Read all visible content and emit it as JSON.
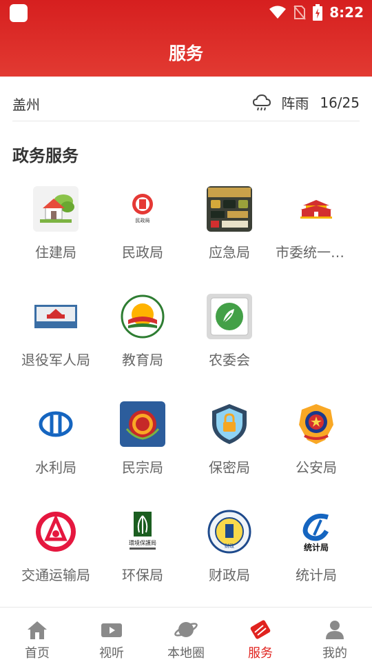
{
  "status": {
    "time": "8:22"
  },
  "header": {
    "title": "服务"
  },
  "weather": {
    "city": "盖州",
    "icon": "rain-cloud-icon",
    "desc": "阵雨",
    "temp": "16/25"
  },
  "section": {
    "title": "政务服务"
  },
  "services": [
    {
      "label": "住建局",
      "icon": "house-icon"
    },
    {
      "label": "民政局",
      "icon": "civil-affairs-emblem-icon"
    },
    {
      "label": "应急局",
      "icon": "emergency-badges-icon"
    },
    {
      "label": "市委统一战…",
      "icon": "gate-tower-icon"
    },
    {
      "label": "退役军人局",
      "icon": "veterans-sign-icon"
    },
    {
      "label": "教育局",
      "icon": "sunrise-emblem-icon"
    },
    {
      "label": "农委会",
      "icon": "agriculture-leaf-icon"
    },
    {
      "label": "水利局",
      "icon": "water-conservancy-logo-icon"
    },
    {
      "label": "民宗局",
      "icon": "ethnic-religion-emblem-icon"
    },
    {
      "label": "保密局",
      "icon": "shield-lock-icon"
    },
    {
      "label": "公安局",
      "icon": "police-badge-icon"
    },
    {
      "label": "交通运输局",
      "icon": "transport-logo-icon"
    },
    {
      "label": "环保局",
      "icon": "environment-tree-icon"
    },
    {
      "label": "财政局",
      "icon": "finance-seal-icon"
    },
    {
      "label": "统计局",
      "icon": "statistics-logo-icon"
    }
  ],
  "service_texts": {
    "finance_seal": "财政",
    "statistics": "统计局",
    "environment": "環境保護局",
    "civil_affairs": "民政局"
  },
  "tabs": [
    {
      "label": "首页",
      "icon": "home-icon"
    },
    {
      "label": "视听",
      "icon": "video-icon"
    },
    {
      "label": "本地圈",
      "icon": "planet-icon"
    },
    {
      "label": "服务",
      "icon": "service-icon"
    },
    {
      "label": "我的",
      "icon": "user-icon"
    }
  ],
  "colors": {
    "brand": "#e0231f",
    "tab_inactive": "#888888"
  }
}
